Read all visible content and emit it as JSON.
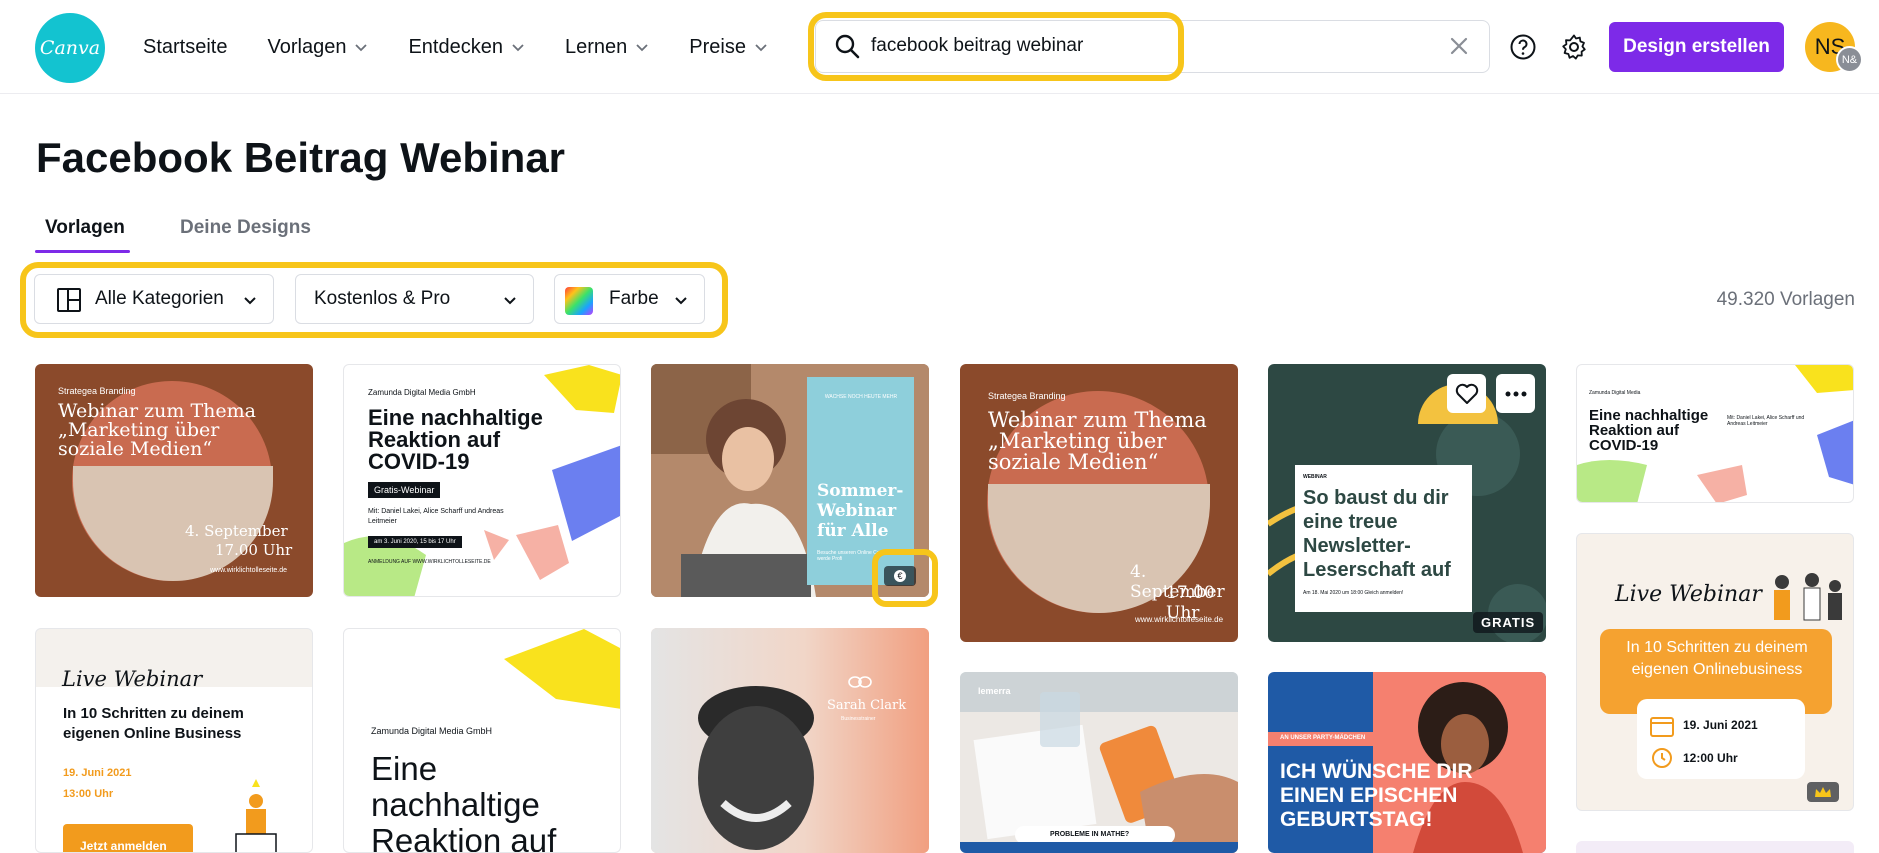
{
  "header": {
    "logo_text": "Canva",
    "nav": [
      {
        "label": "Startseite",
        "has_dropdown": false
      },
      {
        "label": "Vorlagen",
        "has_dropdown": true
      },
      {
        "label": "Entdecken",
        "has_dropdown": true
      },
      {
        "label": "Lernen",
        "has_dropdown": true
      },
      {
        "label": "Preise",
        "has_dropdown": true
      }
    ],
    "search": {
      "value": "facebook beitrag webinar",
      "icon": "search-icon"
    },
    "create_button": "Design erstellen",
    "avatar_initials": "NS",
    "avatar_badge": "N&"
  },
  "page": {
    "title": "Facebook Beitrag Webinar",
    "tabs": [
      {
        "label": "Vorlagen",
        "active": true
      },
      {
        "label": "Deine Designs",
        "active": false
      }
    ],
    "filters": [
      {
        "label": "Alle Kategorien",
        "icon": "layout-grid-icon"
      },
      {
        "label": "Kostenlos & Pro"
      },
      {
        "label": "Farbe",
        "icon": "color-swatch-icon"
      }
    ],
    "result_count": "49.320 Vorlagen"
  },
  "cards": {
    "c1": {
      "brand": "Strategea Branding",
      "title": "Webinar zum Thema „Marketing über soziale Medien“",
      "date": "4. September",
      "time": "17.00 Uhr",
      "url": "www.wirklichtolleseite.de"
    },
    "c2": {
      "brand": "Zamunda Digital Media GmbH",
      "title": "Eine nachhaltige Reaktion auf COVID-19",
      "tag": "Gratis-Webinar",
      "speakers": "Mit: Daniel Lakei, Alice Scharff und Andreas Leitmeier",
      "date": "am 3. Juni 2020, 15 bis 17 Uhr",
      "url": "ANMELDUNG AUF WWW.WIRKLICHTOLLESEITE.DE"
    },
    "c3": {
      "brand": "WACHSE NOCH HEUTE MEHR",
      "title": "Sommer-Webinar für Alle",
      "sub": "Besuche unseren Online Campus & werde Profi"
    },
    "c4": {
      "brand": "Strategea Branding",
      "title": "Webinar zum Thema „Marketing über soziale Medien“",
      "date": "4. September",
      "time": "17.00 Uhr",
      "url": "www.wirklichtolleseite.de"
    },
    "c5": {
      "label": "WEBINAR",
      "title": "So baust du dir eine treue Newsletter-Leserschaft auf",
      "date": "Am 18. Mai 2020 um 18:00 Gleich anmelden!",
      "badge": "GRATIS"
    },
    "c6": {
      "brand": "Zamunda Digital Media",
      "title": "Eine nachhaltige Reaktion auf COVID-19",
      "speakers": "Mit: Daniel Lakei, Alice Scharff und Andreas Leitmeier"
    },
    "c7": {
      "script": "Live Webinar",
      "title": "In 10 Schritten zu deinem eigenen Online Business",
      "date": "19. Juni 2021",
      "time": "13:00 Uhr",
      "button": "Jetzt anmelden"
    },
    "c8": {
      "brand": "Zamunda Digital Media GmbH",
      "title": "Eine nachhaltige Reaktion auf"
    },
    "c9": {
      "name": "Sarah Clark",
      "sub": "Businesstrainer"
    },
    "c10": {
      "brand": "lemerra",
      "search": "PROBLEME IN MATHE?"
    },
    "c11": {
      "small": "AN UNSER PARTY-MÄDCHEN",
      "title": "ICH WÜNSCHE DIR EINEN EPISCHEN GEBURTSTAG!"
    },
    "c12": {
      "script": "Live Webinar",
      "title": "In 10 Schritten zu deinem eigenen Onlinebusiness",
      "date": "19. Juni 2021",
      "time": "12:00 Uhr"
    }
  },
  "colors": {
    "brand_purple": "#7d2ae8",
    "canva_teal": "#13c3d0",
    "highlight": "#f7c51a"
  }
}
